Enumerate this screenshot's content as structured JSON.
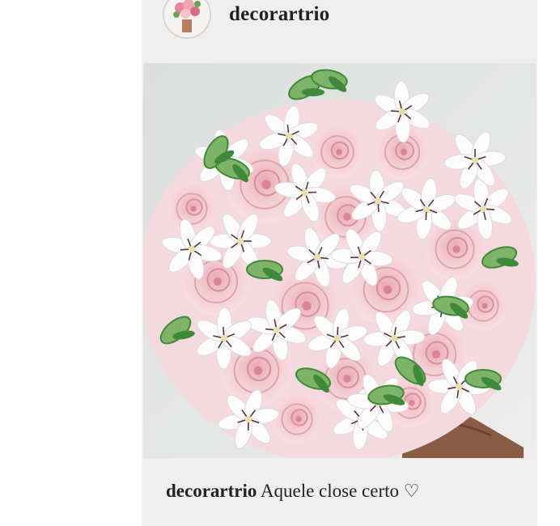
{
  "post": {
    "username": "decorartrio",
    "caption_user": "decorartrio",
    "caption_text": "Aquele close certo",
    "caption_icon": "heart-outline-icon",
    "caption_icon_glyph": "♡"
  },
  "colors": {
    "card_bg": "#efefef",
    "page_bg": "#ffffff",
    "text": "#222222",
    "rose_pink": "#f2c9cf",
    "leaf_green": "#3f8a3a"
  }
}
